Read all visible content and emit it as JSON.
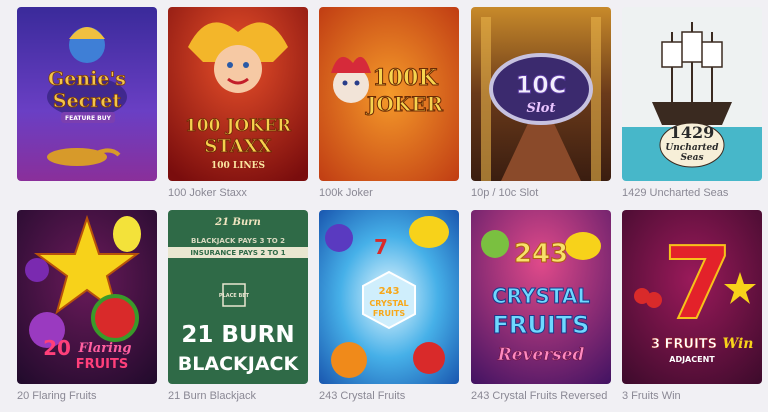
{
  "games": [
    {
      "caption": "",
      "art": {
        "line1": "Genie's",
        "line2": "Secret",
        "badge": "FEATURE BUY"
      }
    },
    {
      "caption": "100 Joker Staxx",
      "art": {
        "line1": "100 JOKER",
        "line2": "STAXX",
        "line3": "100 LINES"
      }
    },
    {
      "caption": "100k Joker",
      "art": {
        "line1": "100K",
        "line2": "JOKER"
      }
    },
    {
      "caption": "10p / 10c Slot",
      "art": {
        "line1": "10C",
        "line2": "Slot"
      }
    },
    {
      "caption": "1429 Uncharted Seas",
      "art": {
        "line1": "1429",
        "line2": "Uncharted",
        "line3": "Seas"
      }
    },
    {
      "caption": "20 Flaring Fruits",
      "art": {
        "line1": "20",
        "line2": "Flaring",
        "line3": "FRUITS"
      }
    },
    {
      "caption": "21 Burn Blackjack",
      "art": {
        "line1": "21 BURN",
        "line2": "BLACKJACK",
        "top": "21 Burn",
        "felt1": "BLACKJACK PAYS 3 TO 2",
        "felt2": "INSURANCE PAYS 2 TO 1",
        "placebet": "PLACE BET"
      }
    },
    {
      "caption": "243 Crystal Fruits",
      "art": {
        "line1": "243",
        "line2": "CRYSTAL",
        "line3": "FRUITS"
      }
    },
    {
      "caption": "243 Crystal Fruits Reversed",
      "art": {
        "line1": "243",
        "line2": "CRYSTAL",
        "line3": "FRUITS",
        "line4": "Reversed"
      }
    },
    {
      "caption": "3 Fruits Win",
      "art": {
        "line1": "7",
        "line2": "3 FRUITS",
        "line3": "Win",
        "line4": "ADJACENT"
      }
    }
  ],
  "colors": {
    "background": "#f1f0f4",
    "caption": "#8a8894"
  }
}
